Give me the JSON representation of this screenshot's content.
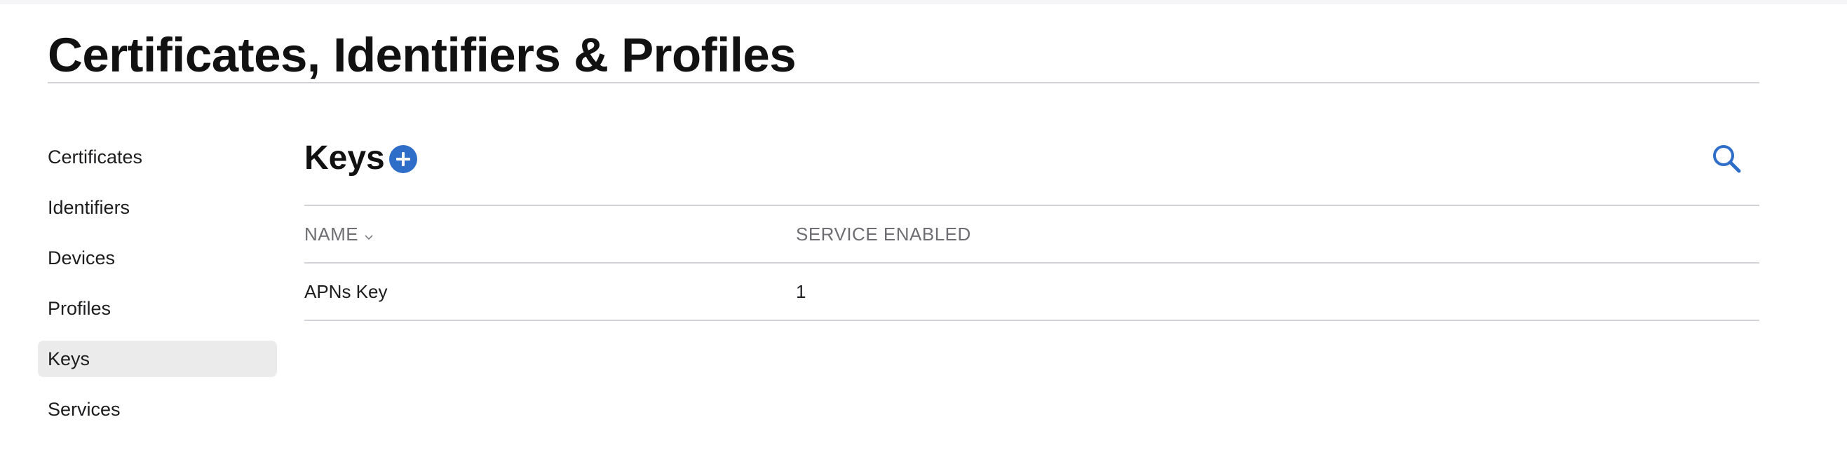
{
  "page": {
    "title": "Certificates, Identifiers & Profiles"
  },
  "sidebar": {
    "items": [
      {
        "label": "Certificates",
        "active": false
      },
      {
        "label": "Identifiers",
        "active": false
      },
      {
        "label": "Devices",
        "active": false
      },
      {
        "label": "Profiles",
        "active": false
      },
      {
        "label": "Keys",
        "active": true
      },
      {
        "label": "Services",
        "active": false
      }
    ]
  },
  "main": {
    "section_title": "Keys",
    "add_icon": "plus-circle-icon",
    "search_icon": "search-icon",
    "table": {
      "columns": [
        "NAME",
        "SERVICE ENABLED"
      ],
      "sort_icon": "chevron-down-icon",
      "rows": [
        {
          "name": "APNs Key",
          "services_enabled": "1"
        }
      ]
    }
  },
  "colors": {
    "accent": "#2e6ec8",
    "active_bg": "#ebebeb",
    "rule": "#d2d2d7",
    "header_text": "#6e6e73"
  }
}
